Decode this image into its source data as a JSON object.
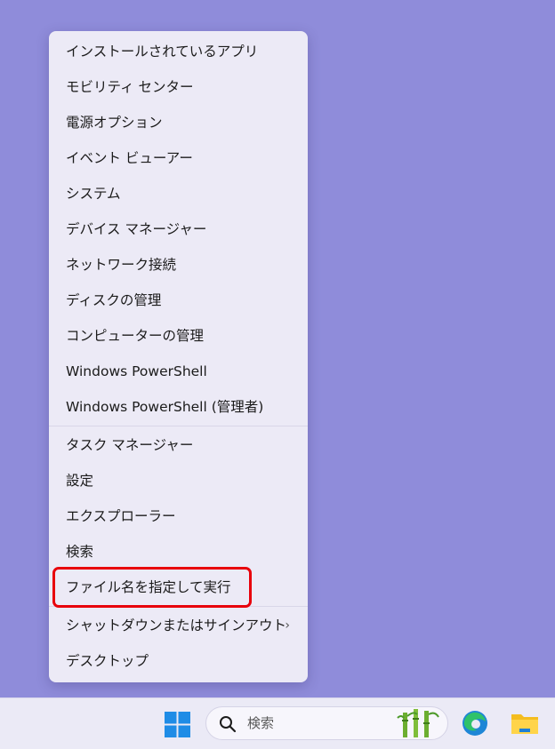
{
  "menu": {
    "items": [
      "インストールされているアプリ",
      "モビリティ センター",
      "電源オプション",
      "イベント ビューアー",
      "システム",
      "デバイス マネージャー",
      "ネットワーク接続",
      "ディスクの管理",
      "コンピューターの管理",
      "Windows PowerShell",
      "Windows PowerShell (管理者)"
    ],
    "items2": [
      "タスク マネージャー",
      "設定",
      "エクスプローラー",
      "検索",
      "ファイル名を指定して実行"
    ],
    "items3": [
      "シャットダウンまたはサインアウト",
      "デスクトップ"
    ],
    "submenu_chevron": "›"
  },
  "taskbar": {
    "search_placeholder": "検索",
    "icons": [
      "windows-start-icon",
      "search-icon",
      "bamboo-icon",
      "edge-icon",
      "file-explorer-icon"
    ]
  },
  "colors": {
    "desktop": "#8f8cda",
    "menu": "#eceaf6",
    "highlight": "#e8000b"
  }
}
